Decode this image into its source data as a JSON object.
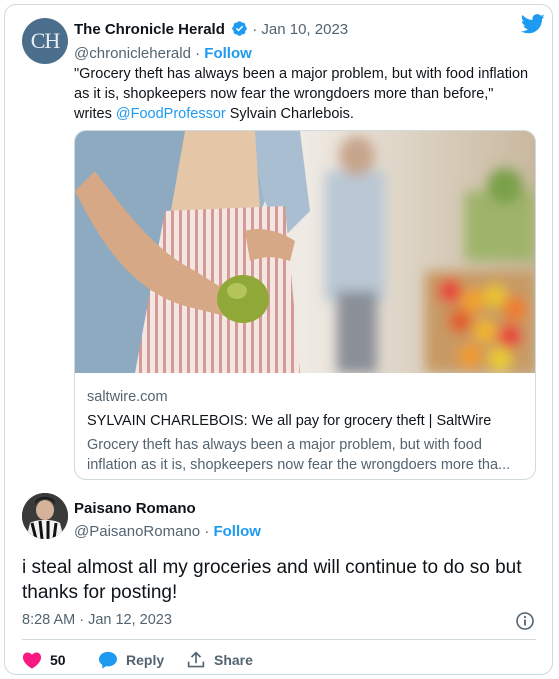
{
  "quoted_tweet": {
    "avatar_text": "CH",
    "name": "The Chronicle Herald",
    "date": "· Jan 10, 2023",
    "handle": "@chronicleherald",
    "separator": "·",
    "follow_label": "Follow",
    "text_before": "\"Grocery theft has always been a major problem, but with food inflation as it is, shopkeepers now fear the wrongdoers more than before,\" writes ",
    "mention": "@FoodProfessor",
    "text_after": " Sylvain Charlebois.",
    "link_card": {
      "domain": "saltwire.com",
      "title": "SYLVAIN CHARLEBOIS: We all pay for grocery theft | SaltWire",
      "description": "Grocery theft has always been a major problem, but with food inflation as it is, shopkeepers now fear the wrongdoers more tha..."
    }
  },
  "reply_tweet": {
    "name": "Paisano Romano",
    "handle": "@PaisanoRomano",
    "separator": "·",
    "follow_label": "Follow",
    "text": "i steal almost all my groceries and will continue to do so but thanks for posting!",
    "timestamp": "8:28 AM · Jan 12, 2023"
  },
  "actions": {
    "like_count": "50",
    "reply_label": "Reply",
    "share_label": "Share"
  },
  "colors": {
    "accent": "#1d9bf0",
    "like": "#f91880",
    "muted": "#536471",
    "border": "#cfd9de"
  },
  "icons": {
    "verified": "verified-badge-icon",
    "twitter": "twitter-bird-icon",
    "info": "info-icon",
    "like": "heart-icon",
    "reply": "speech-bubble-icon",
    "share": "share-upload-icon"
  }
}
